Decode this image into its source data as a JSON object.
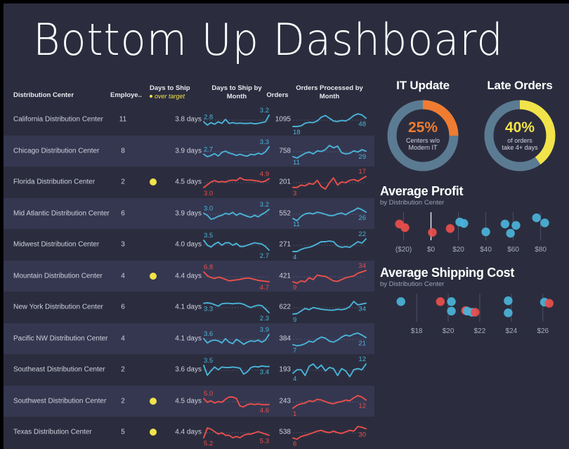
{
  "title": "Bottom Up Dashboard",
  "theme": {
    "bg": "#2b2d3e",
    "row_alt": "#353750",
    "blue": "#4ab3d8",
    "red": "#ea4f4b",
    "yellow": "#f2e34a",
    "orange": "#f07c31",
    "steel": "#5b7b92",
    "text": "#cfd2dd"
  },
  "table": {
    "headers": {
      "center": "Distribution Center",
      "employees": "Employe..",
      "days_to_ship": "Days to Ship",
      "days_to_ship_sub": "over target",
      "days_by_month": "Days to Ship by Month",
      "orders": "Orders",
      "orders_by_month": "Orders Processed by Month"
    },
    "rows": [
      {
        "center": "California Distribution Center",
        "employees": "11",
        "over_target": false,
        "days": "3.8 days",
        "orders": "1095",
        "ship_spark": {
          "color": "#4ab3d8",
          "start_label": "2.8",
          "end_label": "3.2",
          "start_pos": "above",
          "end_pos": "above",
          "values": [
            2.8,
            2.6,
            2.75,
            2.65,
            2.8,
            2.7,
            2.95,
            2.7,
            2.75,
            2.7,
            2.72,
            2.7,
            2.7,
            2.72,
            2.68,
            2.7,
            2.75,
            2.8,
            3.2
          ]
        },
        "orders_spark": {
          "color": "#4ab3d8",
          "start_label": "18",
          "end_label": "48",
          "start_pos": "below",
          "end_pos": "below",
          "values": [
            18,
            18,
            20,
            30,
            33,
            32,
            38,
            52,
            58,
            48,
            38,
            36,
            40,
            38,
            46,
            58,
            64,
            60,
            48
          ]
        }
      },
      {
        "center": "Chicago Distribution Center",
        "employees": "8",
        "over_target": false,
        "days": "3.9 days",
        "orders": "758",
        "ship_spark": {
          "color": "#4ab3d8",
          "start_label": "2.7",
          "end_label": "3.3",
          "start_pos": "above",
          "end_pos": "above",
          "values": [
            2.7,
            2.5,
            2.6,
            2.75,
            2.55,
            2.85,
            2.95,
            2.8,
            2.72,
            2.6,
            2.7,
            2.6,
            2.55,
            2.7,
            2.65,
            2.78,
            2.7,
            2.9,
            3.3
          ]
        },
        "orders_spark": {
          "color": "#4ab3d8",
          "start_label": "11",
          "end_label": "29",
          "start_pos": "below",
          "end_pos": "below",
          "values": [
            11,
            6,
            14,
            22,
            26,
            20,
            30,
            28,
            34,
            48,
            40,
            46,
            24,
            20,
            22,
            30,
            26,
            34,
            29
          ]
        }
      },
      {
        "center": "Florida Distribution Center",
        "employees": "2",
        "over_target": true,
        "days": "4.5 days",
        "orders": "201",
        "ship_spark": {
          "color": "#ea4f4b",
          "start_label": "3.0",
          "end_label": "4.9",
          "start_pos": "below",
          "end_pos": "above",
          "values": [
            3.0,
            3.6,
            4.2,
            4.5,
            4.2,
            4.3,
            4.2,
            4.5,
            4.6,
            4.5,
            5.1,
            4.7,
            4.6,
            4.6,
            4.5,
            4.4,
            4.2,
            4.4,
            4.9
          ]
        },
        "orders_spark": {
          "color": "#ea4f4b",
          "start_label": "3",
          "end_label": "17",
          "start_pos": "below",
          "end_pos": "above",
          "values": [
            3,
            3,
            6,
            5,
            8,
            7,
            12,
            4,
            1,
            9,
            15,
            6,
            10,
            9,
            12,
            13,
            11,
            14,
            17
          ]
        }
      },
      {
        "center": "Mid Atlantic Distribution Center",
        "employees": "6",
        "over_target": false,
        "days": "3.9 days",
        "orders": "552",
        "ship_spark": {
          "color": "#4ab3d8",
          "start_label": "3.0",
          "end_label": "3.2",
          "start_pos": "above",
          "end_pos": "above",
          "values": [
            3.0,
            2.9,
            2.7,
            2.75,
            2.85,
            2.9,
            3.0,
            2.95,
            3.05,
            2.9,
            3.0,
            2.92,
            2.85,
            2.8,
            2.9,
            2.82,
            2.95,
            3.05,
            3.2
          ]
        },
        "orders_spark": {
          "color": "#4ab3d8",
          "start_label": "11",
          "end_label": "26",
          "start_pos": "below",
          "end_pos": "below",
          "values": [
            11,
            6,
            16,
            22,
            24,
            22,
            26,
            24,
            21,
            18,
            18,
            22,
            24,
            20,
            26,
            30,
            36,
            32,
            26
          ]
        }
      },
      {
        "center": "Midwest Distribution Center",
        "employees": "3",
        "over_target": false,
        "days": "4.0 days",
        "orders": "271",
        "ship_spark": {
          "color": "#4ab3d8",
          "start_label": "3.5",
          "end_label": "2.7",
          "start_pos": "above",
          "end_pos": "below",
          "values": [
            3.5,
            3.1,
            2.95,
            3.2,
            3.35,
            3.1,
            3.3,
            3.3,
            3.1,
            3.25,
            3.0,
            3.0,
            3.1,
            3.2,
            3.3,
            3.25,
            3.2,
            3.0,
            2.7
          ]
        },
        "orders_spark": {
          "color": "#4ab3d8",
          "start_label": "4",
          "end_label": "22",
          "start_pos": "below",
          "end_pos": "above",
          "values": [
            4,
            4,
            7,
            9,
            10,
            12,
            15,
            18,
            18,
            19,
            18,
            12,
            10,
            11,
            10,
            14,
            18,
            16,
            22
          ]
        }
      },
      {
        "center": "Mountain Distribution Center",
        "employees": "4",
        "over_target": true,
        "days": "4.4 days",
        "orders": "421",
        "ship_spark": {
          "color": "#ea4f4b",
          "start_label": "6.8",
          "end_label": "4.7",
          "start_pos": "above",
          "end_pos": "below",
          "values": [
            6.8,
            6.0,
            5.6,
            5.4,
            5.7,
            5.5,
            5.2,
            4.9,
            5.0,
            5.1,
            5.2,
            5.4,
            5.5,
            5.4,
            5.2,
            5.0,
            4.9,
            4.8,
            4.7
          ]
        },
        "orders_spark": {
          "color": "#ea4f4b",
          "start_label": "9",
          "end_label": "34",
          "start_pos": "below",
          "end_pos": "above",
          "values": [
            9,
            6,
            11,
            9,
            18,
            14,
            24,
            22,
            21,
            16,
            11,
            10,
            14,
            18,
            20,
            22,
            28,
            31,
            34
          ]
        }
      },
      {
        "center": "New York Distribution Center",
        "employees": "6",
        "over_target": false,
        "days": "4.1 days",
        "orders": "622",
        "ship_spark": {
          "color": "#4ab3d8",
          "start_label": "3.3",
          "end_label": "2.3",
          "start_pos": "below",
          "end_pos": "below",
          "values": [
            3.3,
            3.35,
            3.3,
            3.15,
            3.0,
            3.25,
            3.3,
            3.3,
            3.25,
            3.3,
            3.3,
            3.2,
            3.0,
            2.85,
            3.0,
            3.1,
            3.05,
            2.7,
            2.3
          ]
        },
        "orders_spark": {
          "color": "#4ab3d8",
          "start_label": "9",
          "end_label": "34",
          "start_pos": "below",
          "end_pos": "below",
          "values": [
            9,
            10,
            16,
            22,
            19,
            24,
            22,
            20,
            19,
            18,
            18,
            20,
            19,
            21,
            26,
            38,
            30,
            32,
            34
          ]
        }
      },
      {
        "center": "Pacific NW Distribution Center",
        "employees": "4",
        "over_target": false,
        "days": "4.1 days",
        "orders": "384",
        "ship_spark": {
          "color": "#4ab3d8",
          "start_label": "3.6",
          "end_label": "3.9",
          "start_pos": "above",
          "end_pos": "above",
          "values": [
            3.6,
            3.3,
            3.45,
            3.5,
            3.45,
            3.3,
            3.6,
            3.35,
            3.25,
            3.55,
            3.4,
            3.2,
            3.35,
            3.45,
            3.4,
            3.5,
            3.35,
            3.5,
            3.9
          ]
        },
        "orders_spark": {
          "color": "#4ab3d8",
          "start_label": "7",
          "end_label": "21",
          "start_pos": "below",
          "end_pos": "below",
          "values": [
            7,
            5,
            6,
            9,
            14,
            12,
            18,
            22,
            20,
            14,
            12,
            16,
            22,
            26,
            24,
            28,
            30,
            26,
            21
          ]
        }
      },
      {
        "center": "Southeast Distribution Center",
        "employees": "2",
        "over_target": false,
        "days": "3.6 days",
        "orders": "193",
        "ship_spark": {
          "color": "#4ab3d8",
          "start_label": "3.5",
          "end_label": "3.4",
          "start_pos": "above",
          "end_pos": "below",
          "values": [
            3.5,
            2.6,
            3.0,
            3.35,
            3.1,
            3.35,
            3.3,
            3.3,
            3.35,
            3.3,
            3.25,
            2.7,
            2.9,
            3.3,
            3.4,
            3.35,
            3.45,
            3.4,
            3.4
          ]
        },
        "orders_spark": {
          "color": "#4ab3d8",
          "start_label": "4",
          "end_label": "12",
          "start_pos": "below",
          "end_pos": "above",
          "values": [
            4,
            7,
            7,
            2,
            10,
            12,
            8,
            11,
            6,
            9,
            8,
            2,
            8,
            6,
            1,
            7,
            8,
            7,
            12
          ]
        }
      },
      {
        "center": "Southwest Distribution Center",
        "employees": "2",
        "over_target": true,
        "days": "4.5 days",
        "orders": "243",
        "ship_spark": {
          "color": "#ea4f4b",
          "start_label": "5.0",
          "end_label": "4.6",
          "start_pos": "above",
          "end_pos": "below",
          "values": [
            5.0,
            4.75,
            4.85,
            4.7,
            4.8,
            4.75,
            4.95,
            5.1,
            5.1,
            5.0,
            4.5,
            4.45,
            4.6,
            4.65,
            4.6,
            4.65,
            4.6,
            4.6,
            4.6
          ]
        },
        "orders_spark": {
          "color": "#ea4f4b",
          "start_label": "1",
          "end_label": "12",
          "start_pos": "below",
          "end_pos": "below",
          "values": [
            1,
            5,
            7,
            8,
            11,
            10,
            13,
            12,
            10,
            8,
            7,
            9,
            10,
            12,
            11,
            15,
            18,
            16,
            12
          ]
        }
      },
      {
        "center": "Texas Distribution Center",
        "employees": "5",
        "over_target": true,
        "days": "4.4 days",
        "orders": "538",
        "ship_spark": {
          "color": "#ea4f4b",
          "start_label": "5.2",
          "end_label": "5.3",
          "start_pos": "below",
          "end_pos": "below",
          "values": [
            5.2,
            5.6,
            5.55,
            5.45,
            5.35,
            5.4,
            5.3,
            5.3,
            5.2,
            5.25,
            5.2,
            5.3,
            5.35,
            5.35,
            5.4,
            5.45,
            5.4,
            5.35,
            5.3
          ]
        },
        "orders_spark": {
          "color": "#ea4f4b",
          "start_label": "6",
          "end_label": "30",
          "start_pos": "below",
          "end_pos": "below",
          "values": [
            6,
            3,
            10,
            13,
            16,
            20,
            24,
            26,
            22,
            20,
            24,
            20,
            18,
            22,
            26,
            24,
            36,
            34,
            30
          ]
        }
      }
    ]
  },
  "kpis": [
    {
      "title": "IT Update",
      "percent": "25%",
      "caption_line1": "Centers w/o",
      "caption_line2": "Modern IT",
      "value": 25,
      "color": "#f07c31",
      "track": "#5b7b92"
    },
    {
      "title": "Late Orders",
      "percent": "40%",
      "caption_line1": "of orders",
      "caption_line2": "take 4+ days",
      "value": 40,
      "color": "#f2e34a",
      "track": "#5b7b92"
    }
  ],
  "chart_data": [
    {
      "type": "scatter",
      "title": "Average Profit",
      "subtitle": "by Distribution Center",
      "xlabel": "",
      "ylabel": "",
      "tick_labels": [
        "($20)",
        "$0",
        "$20",
        "$40",
        "$60",
        "$80"
      ],
      "tick_values": [
        -20,
        0,
        20,
        40,
        60,
        80
      ],
      "xlim": [
        -30,
        92
      ],
      "points": [
        {
          "x": -23,
          "y": 0.58,
          "color": "#ea4f4b"
        },
        {
          "x": -19,
          "y": 0.45,
          "color": "#ea4f4b"
        },
        {
          "x": 1,
          "y": 0.28,
          "color": "#ea4f4b"
        },
        {
          "x": 14,
          "y": 0.42,
          "color": "#ea4f4b"
        },
        {
          "x": 21,
          "y": 0.65,
          "color": "#4ab3d8"
        },
        {
          "x": 24,
          "y": 0.6,
          "color": "#4ab3d8"
        },
        {
          "x": 40,
          "y": 0.3,
          "color": "#4ab3d8"
        },
        {
          "x": 54,
          "y": 0.58,
          "color": "#4ab3d8"
        },
        {
          "x": 62,
          "y": 0.53,
          "color": "#4ab3d8"
        },
        {
          "x": 58,
          "y": 0.25,
          "color": "#4ab3d8"
        },
        {
          "x": 77,
          "y": 0.8,
          "color": "#4ab3d8"
        },
        {
          "x": 83,
          "y": 0.62,
          "color": "#4ab3d8"
        }
      ]
    },
    {
      "type": "scatter",
      "title": "Average Shipping Cost",
      "subtitle": "by Distribution Center",
      "xlabel": "",
      "ylabel": "",
      "tick_labels": [
        "$18",
        "$20",
        "$22",
        "$24",
        "$26"
      ],
      "tick_values": [
        18,
        20,
        22,
        24,
        26
      ],
      "xlim": [
        16.3,
        26.9
      ],
      "points": [
        {
          "x": 17.0,
          "y": 0.72,
          "color": "#4ab3d8"
        },
        {
          "x": 19.5,
          "y": 0.72,
          "color": "#ea4f4b"
        },
        {
          "x": 20.2,
          "y": 0.72,
          "color": "#4ab3d8"
        },
        {
          "x": 20.2,
          "y": 0.38,
          "color": "#4ab3d8"
        },
        {
          "x": 21.1,
          "y": 0.4,
          "color": "#ea4f4b"
        },
        {
          "x": 21.2,
          "y": 0.38,
          "color": "#4ab3d8"
        },
        {
          "x": 21.5,
          "y": 0.34,
          "color": "#4ab3d8"
        },
        {
          "x": 21.7,
          "y": 0.34,
          "color": "#ea4f4b"
        },
        {
          "x": 23.8,
          "y": 0.75,
          "color": "#4ab3d8"
        },
        {
          "x": 23.8,
          "y": 0.32,
          "color": "#4ab3d8"
        },
        {
          "x": 26.1,
          "y": 0.7,
          "color": "#4ab3d8"
        },
        {
          "x": 26.4,
          "y": 0.66,
          "color": "#ea4f4b"
        }
      ]
    }
  ]
}
